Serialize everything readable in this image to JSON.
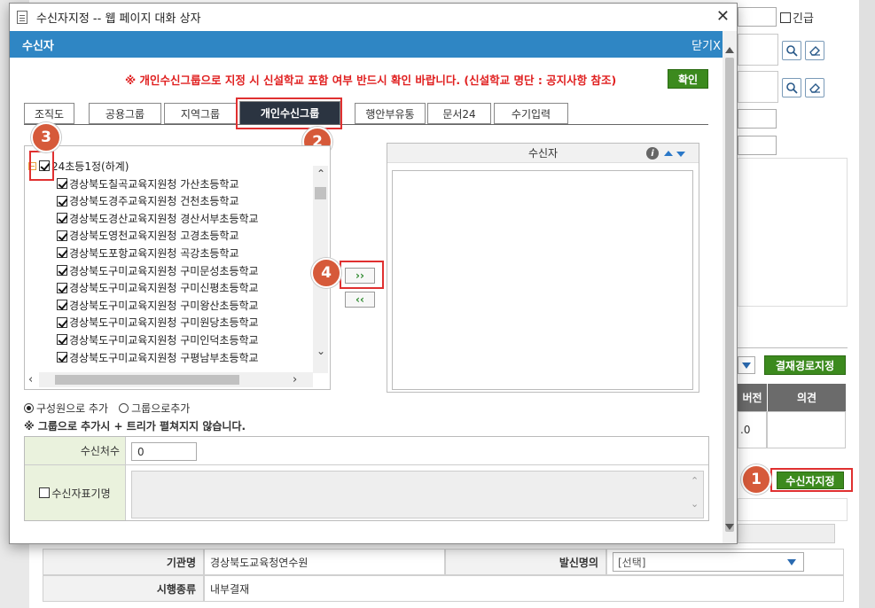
{
  "background": {
    "urgent_label": "긴급",
    "approval_route_button": "결재경로지정",
    "table_headers": [
      "버전",
      "의견"
    ],
    "version_value": ".0",
    "recipient_button": "수신자지정",
    "org_label": "기관명",
    "org_value": "경상북도교육청연수원",
    "sender_label": "발신명의",
    "sender_value": "[선택]",
    "exec_type_label": "시행종류",
    "exec_type_value": "내부결재"
  },
  "dialog": {
    "window_title": "수신자지정 -- 웹 페이지 대화 상자",
    "header_title": "수신자",
    "close_label": "닫기X",
    "notice": "※ 개인수신그룹으로 지정 시 신설학교 포함 여부 반드시 확인 바랍니다. (신설학교 명단 : 공지사항 참조)",
    "confirm_button": "확인",
    "tabs": [
      "조직도",
      "공용그룹",
      "지역그룹",
      "개인수신그룹",
      "행안부유통",
      "문서24",
      "수기입력"
    ],
    "active_tab": "개인수신그룹",
    "tree": {
      "root": "24초등1정(하계)",
      "items": [
        "경상북도칠곡교육지원청 가산초등학교",
        "경상북도경주교육지원청 건천초등학교",
        "경상북도경산교육지원청 경산서부초등학교",
        "경상북도영천교육지원청 고경초등학교",
        "경상북도포항교육지원청 곡강초등학교",
        "경상북도구미교육지원청 구미문성초등학교",
        "경상북도구미교육지원청 구미신평초등학교",
        "경상북도구미교육지원청 구미왕산초등학교",
        "경상북도구미교육지원청 구미원당초등학교",
        "경상북도구미교육지원청 구미인덕초등학교",
        "경상북도구미교육지원청 구평남부초등학교"
      ]
    },
    "add_button": "››",
    "remove_button": "‹‹",
    "recipients_header": "수신자",
    "add_by_member": "구성원으로 추가",
    "add_by_group": "그룹으로추가",
    "group_note": "※ 그룹으로 추가시 + 트리가 펼쳐지지 않습니다.",
    "recipient_count_label": "수신처수",
    "recipient_count_value": "0",
    "recipient_display_label": "수신자표기명"
  },
  "steps": [
    "1",
    "2",
    "3",
    "4"
  ],
  "colors": {
    "blue_header": "#2f86c4",
    "active_tab": "#2b3441",
    "notice_red": "#e02020",
    "green_button": "#3c8a1e",
    "step_badge": "#d65a3a",
    "highlight": "#e03030"
  }
}
